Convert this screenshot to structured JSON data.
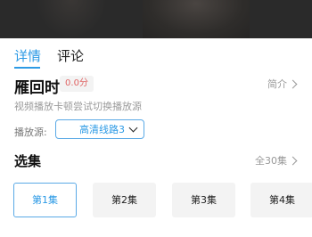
{
  "tabs": [
    {
      "label": "详情",
      "active": true
    },
    {
      "label": "评论",
      "active": false
    }
  ],
  "show": {
    "title": "雁回时",
    "score": "0.0分",
    "intro_label": "简介",
    "hint": "视频播放卡顿尝试切换播放源"
  },
  "source": {
    "label": "播放源:",
    "selected": "高清线路3"
  },
  "episodes": {
    "title": "选集",
    "count_label": "全30集",
    "items": [
      {
        "label": "第1集",
        "active": true
      },
      {
        "label": "第2集",
        "active": false
      },
      {
        "label": "第3集",
        "active": false
      },
      {
        "label": "第4集",
        "active": false
      }
    ]
  },
  "colors": {
    "accent": "#2c9ae5",
    "score": "#e06464"
  }
}
